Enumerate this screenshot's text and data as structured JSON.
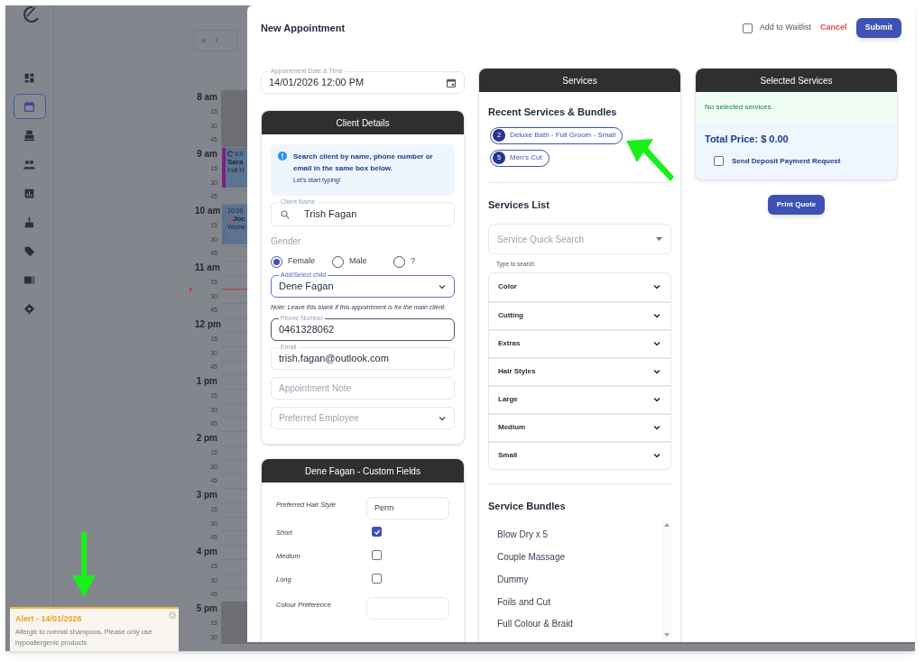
{
  "nav": [
    {
      "selected": false
    },
    {
      "selected": true
    },
    {
      "selected": false
    },
    {
      "selected": false
    },
    {
      "selected": false
    },
    {
      "selected": false
    },
    {
      "selected": false
    },
    {
      "selected": false
    },
    {
      "selected": false
    }
  ],
  "calendar": {
    "nav_buttons": [
      "«",
      "‹"
    ],
    "time_slots": [
      {
        "label": "8 am",
        "hour": true
      },
      {
        "label": "15",
        "hour": false
      },
      {
        "label": "30",
        "hour": false
      },
      {
        "label": "45",
        "hour": false
      },
      {
        "label": "9 am",
        "hour": true
      },
      {
        "label": "15",
        "hour": false
      },
      {
        "label": "30",
        "hour": false
      },
      {
        "label": "45",
        "hour": false
      },
      {
        "label": "10 am",
        "hour": true
      },
      {
        "label": "15",
        "hour": false
      },
      {
        "label": "30",
        "hour": false
      },
      {
        "label": "45",
        "hour": false
      },
      {
        "label": "11 am",
        "hour": true
      },
      {
        "label": "15",
        "hour": false
      },
      {
        "label": "30",
        "hour": false
      },
      {
        "label": "45",
        "hour": false
      },
      {
        "label": "12 pm",
        "hour": true
      },
      {
        "label": "15",
        "hour": false
      },
      {
        "label": "30",
        "hour": false
      },
      {
        "label": "45",
        "hour": false
      },
      {
        "label": "1 pm",
        "hour": true
      },
      {
        "label": "15",
        "hour": false
      },
      {
        "label": "30",
        "hour": false
      },
      {
        "label": "45",
        "hour": false
      },
      {
        "label": "2 pm",
        "hour": true
      },
      {
        "label": "15",
        "hour": false
      },
      {
        "label": "30",
        "hour": false
      },
      {
        "label": "45",
        "hour": false
      },
      {
        "label": "3 pm",
        "hour": true
      },
      {
        "label": "15",
        "hour": false
      },
      {
        "label": "30",
        "hour": false
      },
      {
        "label": "45",
        "hour": false
      },
      {
        "label": "4 pm",
        "hour": true
      },
      {
        "label": "15",
        "hour": false
      },
      {
        "label": "30",
        "hour": false
      },
      {
        "label": "45",
        "hour": false
      },
      {
        "label": "5 pm",
        "hour": true
      },
      {
        "label": "15",
        "hour": false
      },
      {
        "label": "30",
        "hour": false
      }
    ],
    "events": [
      {
        "kind": "recurring",
        "time": "9:0",
        "client": "Sara",
        "service": "Full H",
        "color": "#7a1f86"
      },
      {
        "kind": "locked",
        "time": "10:00",
        "client": "Joc",
        "service": "Wome",
        "color": "#5b6f8c"
      }
    ]
  },
  "alert": {
    "title": "Alert - 14/01/2026",
    "text": "Allergic to normal shampoos. Please only use hypoallergenic products"
  },
  "drawer": {
    "title": "New Appointment",
    "waitlist": {
      "label": "Add to Waitlist",
      "checked": false
    },
    "cancel": "Cancel",
    "submit": "Submit",
    "date_field": {
      "label": "Appointment Date & Time",
      "value": "14/01/2026 12:00 PM"
    },
    "client_details": {
      "title": "Client Details",
      "info_title": "Search client by name, phone number or email in the same box below.",
      "info_hint": "Let's start typing!",
      "client_name": {
        "label": "Client Name",
        "value": "Trish Fagan"
      },
      "gender": {
        "label": "Gender",
        "options": [
          {
            "label": "Female",
            "selected": true
          },
          {
            "label": "Male",
            "selected": false
          },
          {
            "label": "?",
            "selected": false
          }
        ]
      },
      "child": {
        "label": "Add/Select child",
        "value": "Dene Fagan"
      },
      "note": "Note: Leave this blank if this appointment is for the main client.",
      "phone": {
        "label": "Phone Number",
        "value": "0461328062"
      },
      "email": {
        "label": "Email",
        "value": "trish.fagan@outlook.com"
      },
      "appointment_note": {
        "placeholder": "Appointment Note"
      },
      "employee": {
        "placeholder": "Preferred Employee"
      }
    },
    "custom_fields": {
      "title": "Dene Fagan - Custom Fields",
      "rows": [
        {
          "kind": "text",
          "label": "Preferred Hair Style",
          "value": "Perm"
        },
        {
          "kind": "checkbox",
          "label": "Short",
          "checked": true
        },
        {
          "kind": "checkbox",
          "label": "Medium",
          "checked": false
        },
        {
          "kind": "checkbox",
          "label": "Long",
          "checked": false
        },
        {
          "kind": "text",
          "label": "Colour Preference"
        }
      ]
    },
    "services": {
      "title": "Services",
      "recent_title": "Recent Services & Bundles",
      "recent": [
        {
          "count": "2",
          "label": "Deluxe Bath - Full Groom - Small"
        },
        {
          "count": "5",
          "label": "Men's Cut"
        }
      ],
      "list_title": "Services List",
      "search": {
        "placeholder": "Service Quick Search"
      },
      "search_hint": "Type to search",
      "categories": [
        {
          "label": "Color",
          "expanded": false
        },
        {
          "label": "Cutting",
          "expanded": false
        },
        {
          "label": "Extras",
          "expanded": false
        },
        {
          "label": "Hair Styles",
          "expanded": false
        },
        {
          "label": "Large",
          "expanded": false
        },
        {
          "label": "Medium",
          "expanded": false
        },
        {
          "label": "Small",
          "expanded": false
        }
      ],
      "bundles_title": "Service Bundles",
      "bundles": [
        "Blow Dry x 5",
        "Couple Massage",
        "Dummy",
        "Foils and Cut",
        "Full Colour & Braid"
      ]
    },
    "selected_services": {
      "title": "Selected Services",
      "empty": "No selected services.",
      "total": "Total Price: $ 0.00",
      "deposit": {
        "label": "Send Deposit Payment Request",
        "checked": false
      }
    },
    "print_quote": "Print Quote"
  }
}
